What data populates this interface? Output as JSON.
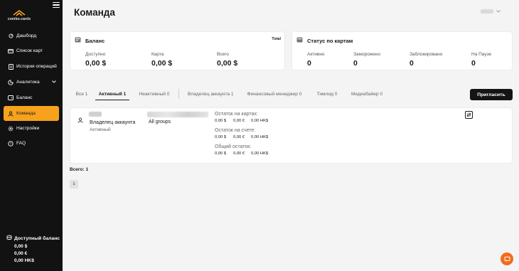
{
  "brand": {
    "logo_text": "combo.cards"
  },
  "sidebar": {
    "items": [
      {
        "label": "Дашборд",
        "icon": "dashboard-icon"
      },
      {
        "label": "Список карт",
        "icon": "card-icon"
      },
      {
        "label": "История операций",
        "icon": "history-icon"
      },
      {
        "label": "Аналитика",
        "icon": "analytics-icon"
      },
      {
        "label": "Баланс",
        "icon": "wallet-icon"
      },
      {
        "label": "Команда",
        "icon": "team-icon"
      },
      {
        "label": "Настройки",
        "icon": "gear-icon"
      },
      {
        "label": "FAQ",
        "icon": "help-icon"
      }
    ],
    "active_index": 5,
    "available_balance": {
      "title": "Доступный баланс",
      "values": [
        "0,00 $",
        "0,00 €",
        "0,00 HK$"
      ]
    }
  },
  "header": {
    "title": "Команда"
  },
  "balance_card": {
    "title": "Баланс",
    "total_label": "Total",
    "stats": [
      {
        "label": "Доступно",
        "value": "0,00 $"
      },
      {
        "label": "Карта",
        "value": "0,00 $"
      },
      {
        "label": "Всего",
        "value": "0,00 $"
      }
    ]
  },
  "cards_status": {
    "title": "Статус по картам",
    "stats": [
      {
        "label": "Активно",
        "value": "0"
      },
      {
        "label": "Заморожено",
        "value": "0"
      },
      {
        "label": "Заблокировано",
        "value": "0"
      },
      {
        "label": "На Паузе",
        "value": "0"
      }
    ]
  },
  "tabs": [
    {
      "label": "Все 1"
    },
    {
      "label": "Активный 1"
    },
    {
      "label": "Неактивный 0"
    },
    {
      "label": "Владелец аккаунта 1"
    },
    {
      "label": "Финансовый менеджер 0"
    },
    {
      "label": "Тимлид 0"
    },
    {
      "label": "Медиабайер 0"
    }
  ],
  "active_tab_index": 1,
  "invite_button": "Пригласить",
  "member": {
    "role": "Владелец аккаунта",
    "status": "Активный",
    "group": "All groups",
    "balances": [
      {
        "label": "Остаток на картах:",
        "values": [
          "0,00 $",
          "0,00 €",
          "0,00 HK$"
        ]
      },
      {
        "label": "Остаток на счете:",
        "values": [
          "0,00 $",
          "0,00 €",
          "0,00 HK$"
        ]
      },
      {
        "label": "Общий остаток:",
        "values": [
          "0,00 $",
          "0,00 €",
          "0,00 HK$"
        ]
      }
    ]
  },
  "footer": {
    "total": "Всего: 1",
    "page": "1"
  },
  "colors": {
    "accent": "#f6a21d",
    "sidebar_bg": "#121212",
    "chat": "#f26c1e"
  }
}
